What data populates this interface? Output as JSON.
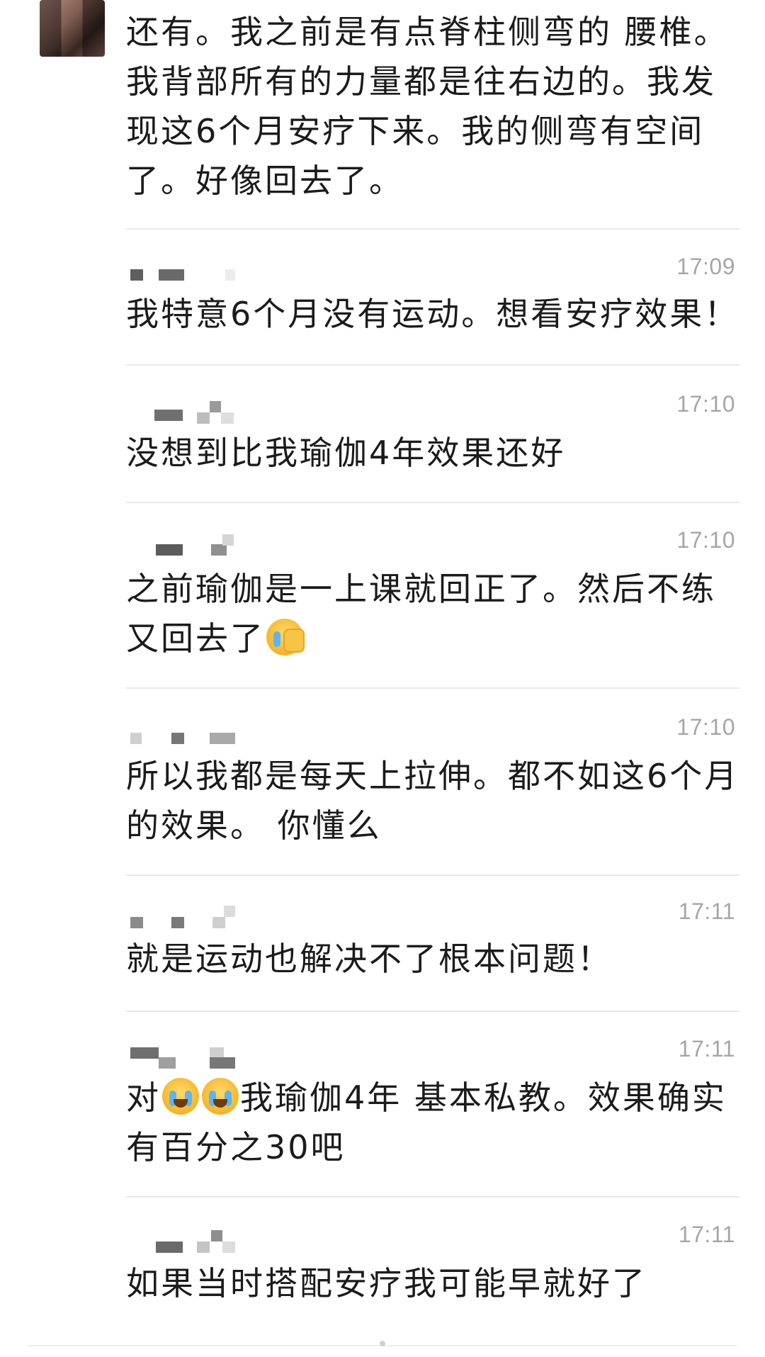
{
  "messages": [
    {
      "time": "",
      "text": "还有。我之前是有点脊柱侧弯的 腰椎。我背部所有的力量都是往右边的。我发现这6个月安疗下来。我的侧弯有空间了。好像回去了。"
    },
    {
      "time": "17:09",
      "text": "我特意6个月没有运动。想看安疗效果！"
    },
    {
      "time": "17:10",
      "text": "没想到比我瑜伽4年效果还好"
    },
    {
      "time": "17:10",
      "text_before": "之前瑜伽是一上课就回正了。然后不练又回去了",
      "emoji": "facepalm-crying-emoji"
    },
    {
      "time": "17:10",
      "text": "所以我都是每天上拉伸。都不如这6个月的效果。 你懂么"
    },
    {
      "time": "17:11",
      "text": "就是运动也解决不了根本问题！"
    },
    {
      "time": "17:11",
      "text_prefix": "对",
      "emoji": "loudly-crying-emoji",
      "text_after": "我瑜伽4年 基本私教。效果确实有百分之30吧"
    },
    {
      "time": "17:11",
      "text": "如果当时搭配安疗我可能早就好了"
    }
  ],
  "colors": {
    "text": "#1b1b1b",
    "time": "#a6a6a6",
    "separator": "#e9e9e9"
  }
}
